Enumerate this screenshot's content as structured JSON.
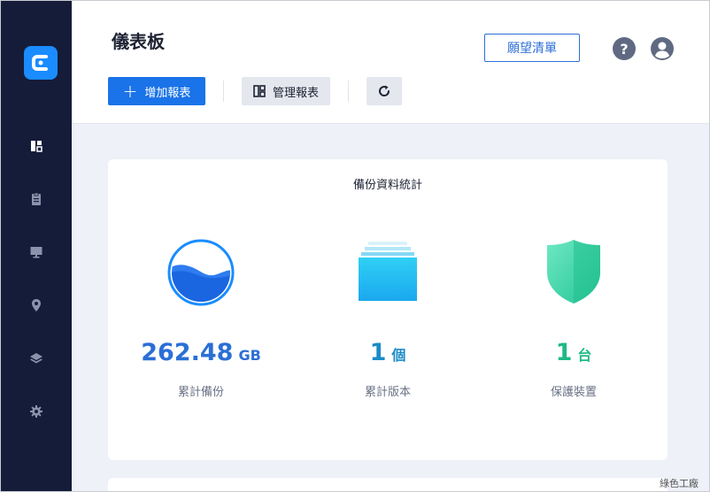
{
  "header": {
    "title": "儀表板",
    "wishlist_label": "願望清單",
    "help_label": "?",
    "add_report_label": "增加報表",
    "manage_report_label": "管理報表"
  },
  "sidebar": {
    "items": [
      {
        "icon": "dashboard-icon"
      },
      {
        "icon": "clipboard-icon"
      },
      {
        "icon": "monitor-icon"
      },
      {
        "icon": "location-pin-icon"
      },
      {
        "icon": "layers-icon"
      },
      {
        "icon": "gear-icon"
      }
    ]
  },
  "stats": {
    "title": "備份資料統計",
    "items": [
      {
        "value": "262.48",
        "unit": "GB",
        "label": "累計備份",
        "color": "#2b6fd6",
        "icon": "water-gauge-icon"
      },
      {
        "value": "1",
        "unit": "個",
        "label": "累計版本",
        "color": "#1a8cc7",
        "icon": "versions-stack-icon"
      },
      {
        "value": "1",
        "unit": "台",
        "label": "保護裝置",
        "color": "#1fb985",
        "icon": "shield-icon"
      }
    ]
  },
  "watermark": "綠色工廠",
  "colors": {
    "sidebar": "#141c3a",
    "primary": "#1a73e8",
    "background": "#eef1f7"
  }
}
